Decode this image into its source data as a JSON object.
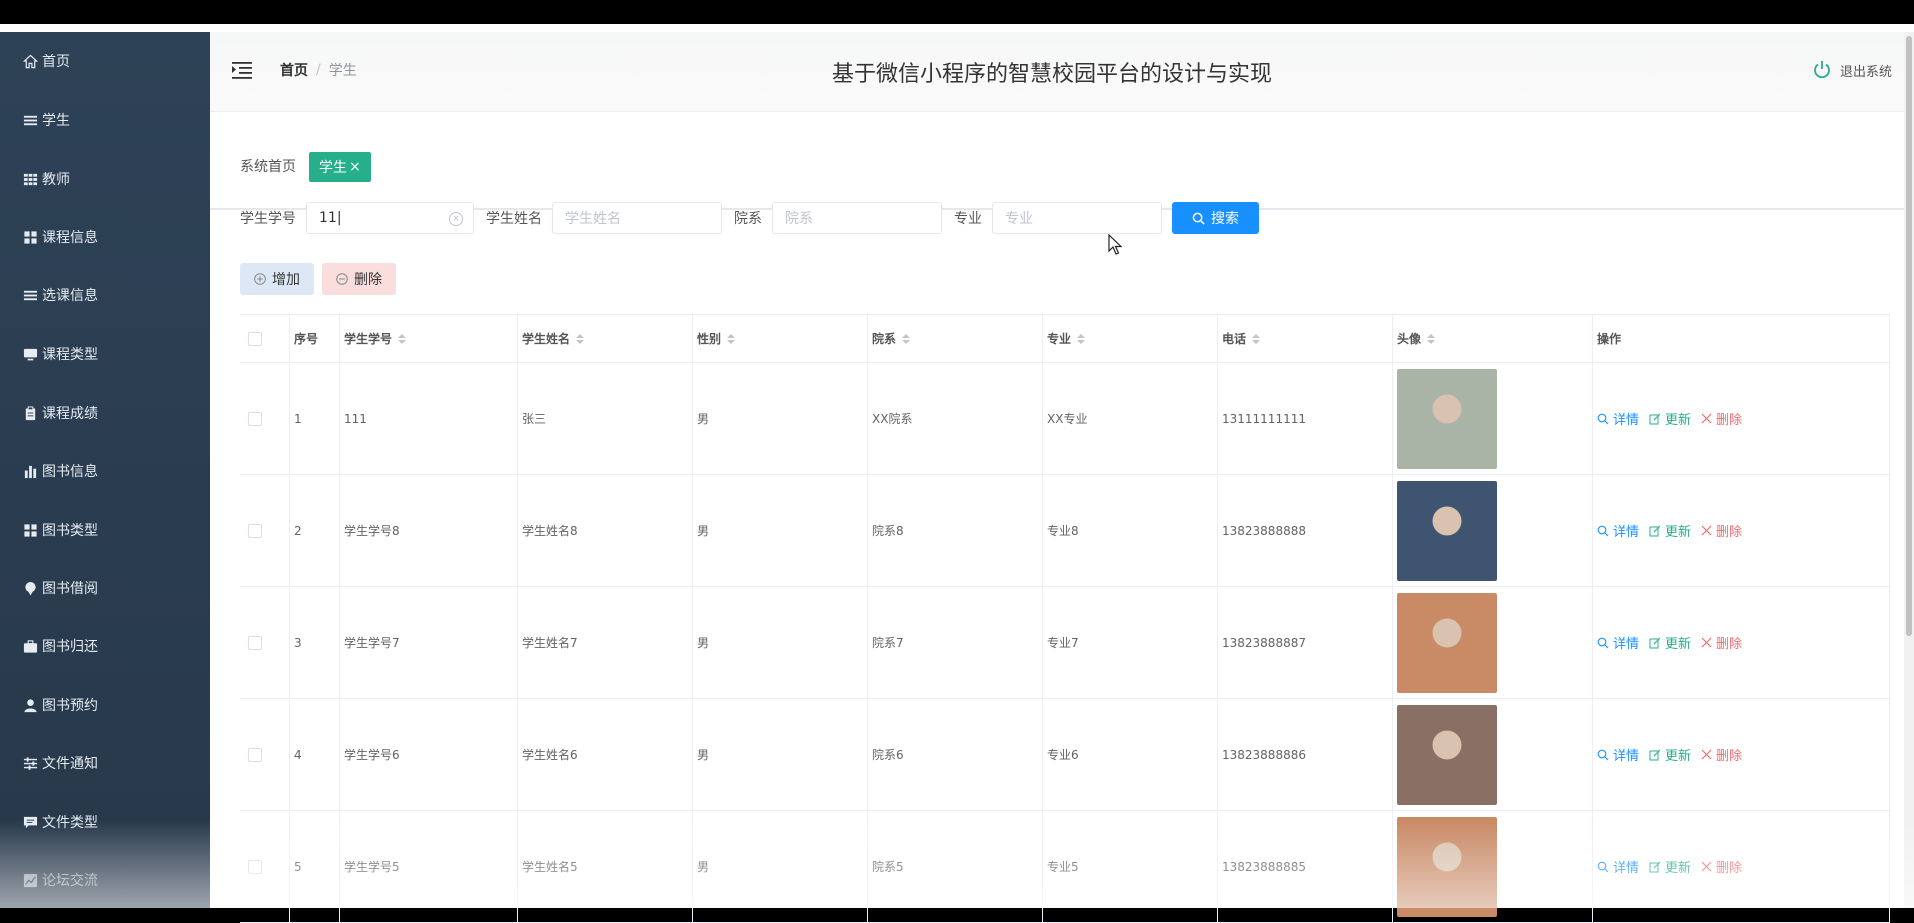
{
  "sidebar": {
    "items": [
      {
        "label": "首页",
        "icon": "home-icon"
      },
      {
        "label": "学生",
        "icon": "list-icon"
      },
      {
        "label": "教师",
        "icon": "grid-icon"
      },
      {
        "label": "课程信息",
        "icon": "apps-icon"
      },
      {
        "label": "选课信息",
        "icon": "list-icon"
      },
      {
        "label": "课程类型",
        "icon": "monitor-icon"
      },
      {
        "label": "课程成绩",
        "icon": "clipboard-icon"
      },
      {
        "label": "图书信息",
        "icon": "bar-chart-icon"
      },
      {
        "label": "图书类型",
        "icon": "apps-icon"
      },
      {
        "label": "图书借阅",
        "icon": "pin-icon"
      },
      {
        "label": "图书归还",
        "icon": "briefcase-icon"
      },
      {
        "label": "图书预约",
        "icon": "user-icon"
      },
      {
        "label": "文件通知",
        "icon": "sliders-icon"
      },
      {
        "label": "文件类型",
        "icon": "comment-icon"
      },
      {
        "label": "论坛交流",
        "icon": "chart-icon"
      }
    ]
  },
  "header": {
    "breadcrumb_home": "首页",
    "breadcrumb_sep": "/",
    "breadcrumb_current": "学生",
    "title": "基于微信小程序的智慧校园平台的设计与实现",
    "logout": "退出系统"
  },
  "tags": {
    "home": "系统首页",
    "active": "学生",
    "close": "×"
  },
  "search": {
    "student_no_label": "学生学号",
    "student_no_value": "11",
    "student_name_label": "学生姓名",
    "student_name_placeholder": "学生姓名",
    "department_label": "院系",
    "department_placeholder": "院系",
    "major_label": "专业",
    "major_placeholder": "专业",
    "search_button": "搜索"
  },
  "actions": {
    "add": "增加",
    "delete": "删除"
  },
  "table": {
    "headers": [
      "序号",
      "学生学号",
      "学生姓名",
      "性别",
      "院系",
      "专业",
      "电话",
      "头像",
      "操作"
    ],
    "ops": {
      "detail": "详情",
      "update": "更新",
      "delete": "删除"
    },
    "rows": [
      {
        "index": "1",
        "no": "111",
        "name": "张三",
        "gender": "男",
        "dept": "XX院系",
        "major": "XX专业",
        "phone": "13111111111",
        "avatar_color": "#a9b3a6"
      },
      {
        "index": "2",
        "no": "学生学号8",
        "name": "学生姓名8",
        "gender": "男",
        "dept": "院系8",
        "major": "专业8",
        "phone": "13823888888",
        "avatar_color": "#3e5470"
      },
      {
        "index": "3",
        "no": "学生学号7",
        "name": "学生姓名7",
        "gender": "男",
        "dept": "院系7",
        "major": "专业7",
        "phone": "13823888887",
        "avatar_color": "#c98a66"
      },
      {
        "index": "4",
        "no": "学生学号6",
        "name": "学生姓名6",
        "gender": "男",
        "dept": "院系6",
        "major": "专业6",
        "phone": "13823888886",
        "avatar_color": "#8a7064"
      },
      {
        "index": "5",
        "no": "学生学号5",
        "name": "学生姓名5",
        "gender": "男",
        "dept": "院系5",
        "major": "专业5",
        "phone": "13823888885",
        "avatar_color": "#c98a66"
      }
    ]
  },
  "colors": {
    "sidebar_bg": "#2e4257",
    "accent_green": "#27ae8a",
    "accent_blue": "#1890ff",
    "danger": "#f56c6c"
  }
}
